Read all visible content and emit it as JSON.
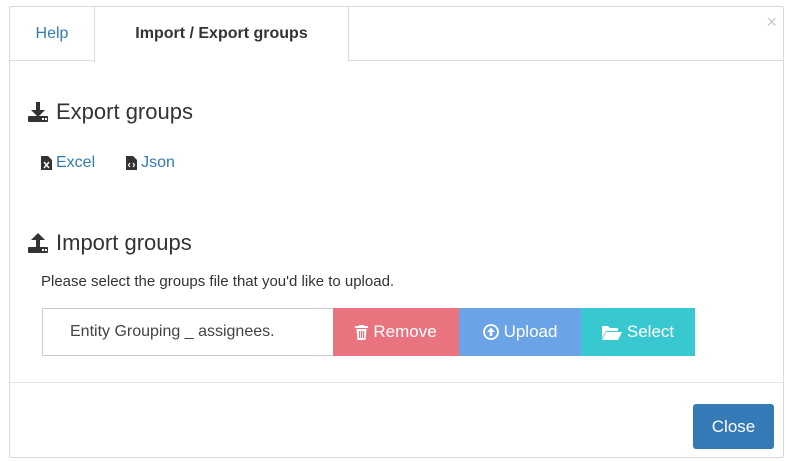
{
  "tabs": [
    {
      "label": "Help",
      "active": false
    },
    {
      "label": "Import / Export groups",
      "active": true
    }
  ],
  "close_icon": "×",
  "export": {
    "title": "Export groups",
    "icon": "download-icon",
    "links": [
      {
        "label": "Excel",
        "icon": "excel-file-icon"
      },
      {
        "label": "Json",
        "icon": "code-file-icon"
      }
    ]
  },
  "import": {
    "title": "Import groups",
    "icon": "upload-icon",
    "description": "Please select the groups file that you'd like to upload.",
    "file_value": "Entity Grouping _ assignees.",
    "buttons": {
      "remove": "Remove",
      "upload": "Upload",
      "select": "Select"
    }
  },
  "footer": {
    "close_label": "Close"
  },
  "colors": {
    "link": "#337ab7",
    "remove": "#e97480",
    "upload": "#6aa3e6",
    "select": "#38c8cf",
    "primary": "#337ab7"
  }
}
